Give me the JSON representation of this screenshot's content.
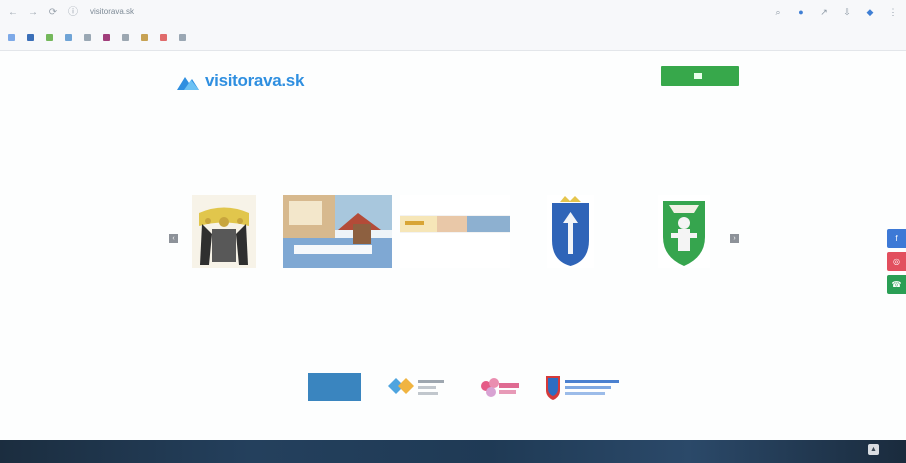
{
  "browser": {
    "url": "visitorava.sk",
    "tab_icons": [
      "back-icon",
      "forward-icon",
      "reload-icon",
      "site-icon"
    ],
    "tool_icons": [
      "search-icon",
      "extension-icon",
      "share-icon",
      "download-icon",
      "profile-icon",
      "menu-icon"
    ],
    "bookmarks": [
      {
        "label": "",
        "color": "#7da9e8"
      },
      {
        "label": "",
        "color": "#3b6fb8"
      },
      {
        "label": "",
        "color": "#74b85b"
      },
      {
        "label": "",
        "color": "#6fa4d6"
      },
      {
        "label": "",
        "color": "#9aa8b4"
      },
      {
        "label": "",
        "color": "#a13e7b"
      },
      {
        "label": "",
        "color": "#9ca7b1"
      },
      {
        "label": "",
        "color": "#c7a253"
      },
      {
        "label": "",
        "color": "#e06b6b"
      },
      {
        "label": "",
        "color": "#9aa7b3"
      }
    ]
  },
  "site": {
    "logo_text": "visitorava.sk",
    "nav_items": [
      "",
      "",
      "",
      "",
      ""
    ],
    "cta_label": "",
    "center_title": "",
    "center_link": "",
    "bottom_link": "",
    "footer_note": ""
  },
  "colors": {
    "brand_blue": "#2f8fe0",
    "cta_green": "#37a84b"
  },
  "carousel": {
    "left_arrow": "‹",
    "right_arrow": "›",
    "slides": [
      {
        "name": "coat-of-arms-with-crowned-eagles"
      },
      {
        "name": "landscape-collage"
      },
      {
        "name": "promo-banner"
      },
      {
        "name": "blue-coat-of-arms"
      },
      {
        "name": "green-coat-of-arms"
      }
    ]
  },
  "partners": [
    {
      "name": "partner-logo-1"
    },
    {
      "name": "partner-logo-2"
    },
    {
      "name": "partner-logo-3"
    },
    {
      "name": "partner-logo-4"
    }
  ],
  "socials": [
    {
      "icon": "facebook-icon",
      "glyph": "f"
    },
    {
      "icon": "instagram-icon",
      "glyph": "◎"
    },
    {
      "icon": "phone-icon",
      "glyph": "☎"
    }
  ],
  "scroll_up": "▲"
}
